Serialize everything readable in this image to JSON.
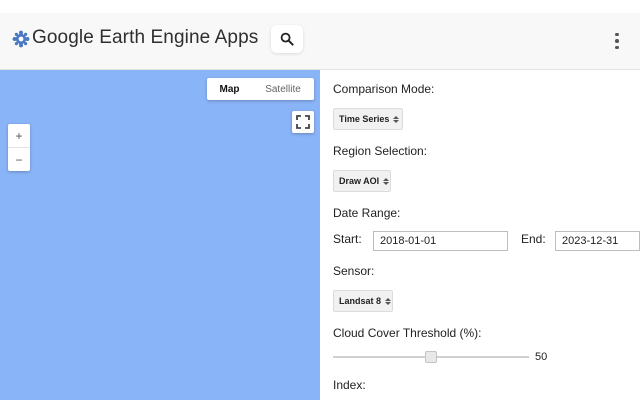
{
  "header": {
    "app_title": "Google Earth Engine Apps",
    "logo_icon": "earth-engine-logo-icon",
    "search_icon": "search-icon",
    "more_icon": "more-vertical-icon"
  },
  "map": {
    "background_color": "#8ab4f8",
    "map_type_options": [
      "Map",
      "Satellite"
    ],
    "selected_map_type": "Map",
    "zoom_in_label": "+",
    "zoom_out_label": "−"
  },
  "panel": {
    "comparison_mode": {
      "label": "Comparison Mode:",
      "value": "Time Series"
    },
    "region_selection": {
      "label": "Region Selection:",
      "value": "Draw AOI"
    },
    "date_range": {
      "label": "Date Range:",
      "start_label": "Start:",
      "start_value": "2018-01-01",
      "end_label": "End:",
      "end_value": "2023-12-31"
    },
    "sensor": {
      "label": "Sensor:",
      "value": "Landsat 8"
    },
    "cloud_cover": {
      "label": "Cloud Cover Threshold (%):",
      "value": "50",
      "min": 0,
      "max": 100
    },
    "index": {
      "label": "Index:"
    }
  }
}
